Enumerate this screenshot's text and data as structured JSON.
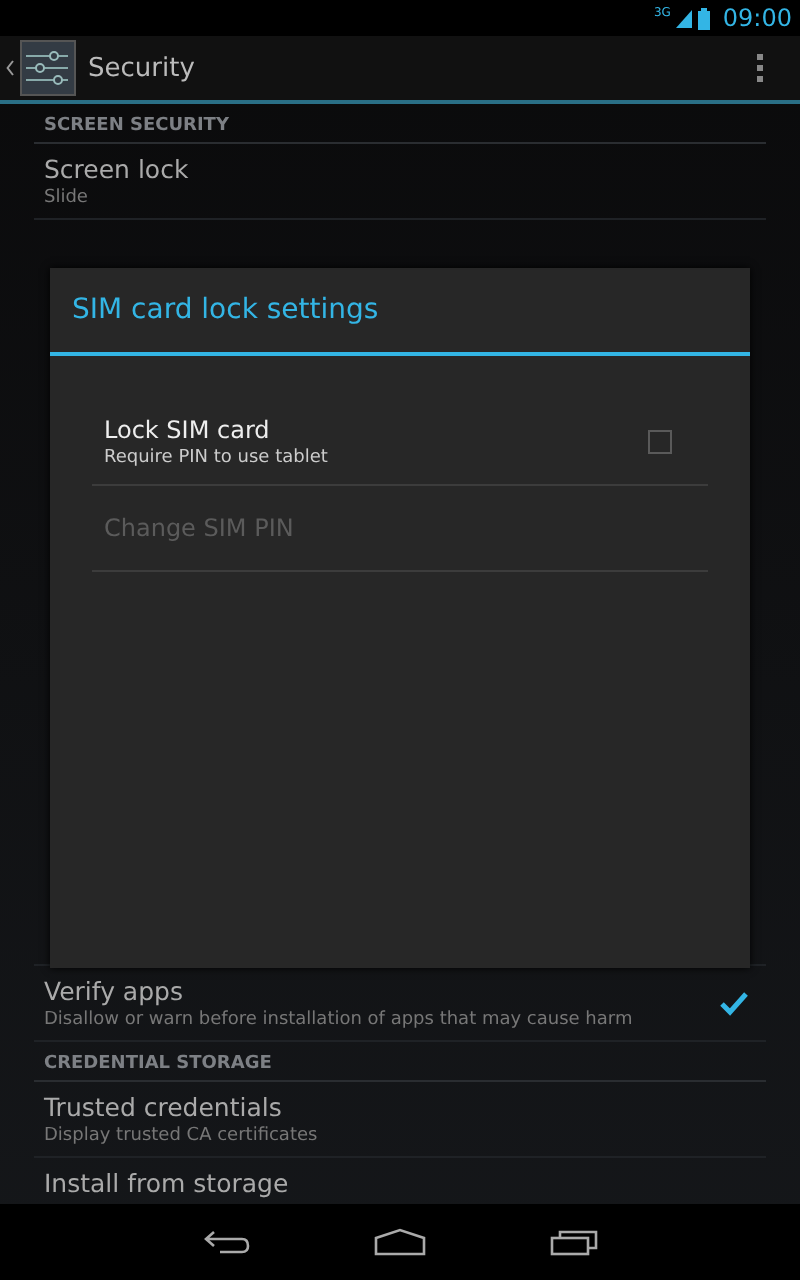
{
  "status_bar": {
    "network": "3G",
    "time": "09:00"
  },
  "action_bar": {
    "title": "Security"
  },
  "sections": [
    {
      "header": "SCREEN SECURITY",
      "items": [
        {
          "kind": "item",
          "title": "Screen lock",
          "summary": "Slide"
        }
      ]
    },
    {
      "items": [
        {
          "kind": "check",
          "title": "Verify apps",
          "summary": "Disallow or warn before installation of apps that may cause harm",
          "checked": true
        }
      ]
    },
    {
      "header": "CREDENTIAL STORAGE",
      "items": [
        {
          "kind": "item",
          "title": "Trusted credentials",
          "summary": "Display trusted CA certificates"
        },
        {
          "kind": "item",
          "title": "Install from storage"
        }
      ]
    }
  ],
  "dialog": {
    "title": "SIM card lock settings",
    "items": [
      {
        "kind": "checkbox",
        "title": "Lock SIM card",
        "summary": "Require PIN to use tablet",
        "checked": false,
        "disabled": false
      },
      {
        "kind": "plain",
        "title": "Change SIM PIN",
        "disabled": true
      }
    ]
  }
}
